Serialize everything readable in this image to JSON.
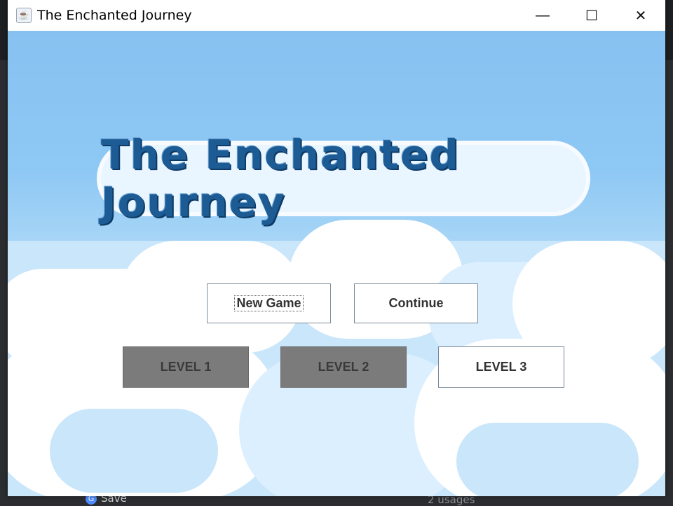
{
  "ide": {
    "save_label": "Save",
    "usages_label": "2 usages"
  },
  "window": {
    "title": "The Enchanted Journey",
    "icon": "java-coffee-icon",
    "controls": {
      "minimize": "—",
      "maximize": "☐",
      "close": "✕"
    }
  },
  "game": {
    "logo_text": "The Enchanted Journey",
    "buttons": {
      "new_game": "New Game",
      "continue": "Continue"
    },
    "levels": [
      {
        "label": "LEVEL 1",
        "state": "locked"
      },
      {
        "label": "LEVEL 2",
        "state": "locked"
      },
      {
        "label": "LEVEL 3",
        "state": "available"
      }
    ]
  },
  "colors": {
    "sky": "#8ec8f4",
    "logo_text": "#1c5b94",
    "locked_level": "#7b7b7b",
    "available_level": "#ffffff"
  }
}
